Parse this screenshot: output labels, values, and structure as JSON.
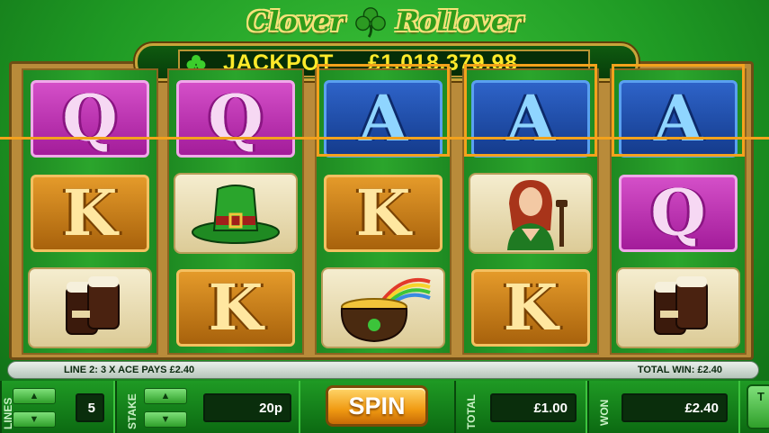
{
  "game": {
    "title_word1": "Clover",
    "title_word2": "Rollover"
  },
  "jackpot": {
    "label": "JACKPOT",
    "amount": "£1,018,379.98"
  },
  "reels": [
    {
      "symbols": [
        "Q",
        "K",
        "ale"
      ]
    },
    {
      "symbols": [
        "Q",
        "hat",
        "K"
      ]
    },
    {
      "symbols": [
        "A",
        "K",
        "pot"
      ]
    },
    {
      "symbols": [
        "A",
        "lady",
        "K"
      ]
    },
    {
      "symbols": [
        "A",
        "Q",
        "ale"
      ]
    }
  ],
  "info": {
    "line_message": "LINE 2: 3 X ACE PAYS £2.40",
    "total_win": "TOTAL WIN: £2.40"
  },
  "controls": {
    "lines_label": "LINES",
    "lines_value": "5",
    "stake_label": "STAKE",
    "stake_value": "20p",
    "spin_label": "SPIN",
    "total_label": "TOTAL",
    "total_value": "£1.00",
    "won_label": "WON",
    "won_value": "£2.40",
    "edge_label": "T"
  },
  "colors": {
    "background_green": "#1f9a24",
    "jackpot_yellow": "#ffea2a",
    "win_line_orange": "#f3a21c",
    "spin_orange": "#f09a12"
  }
}
